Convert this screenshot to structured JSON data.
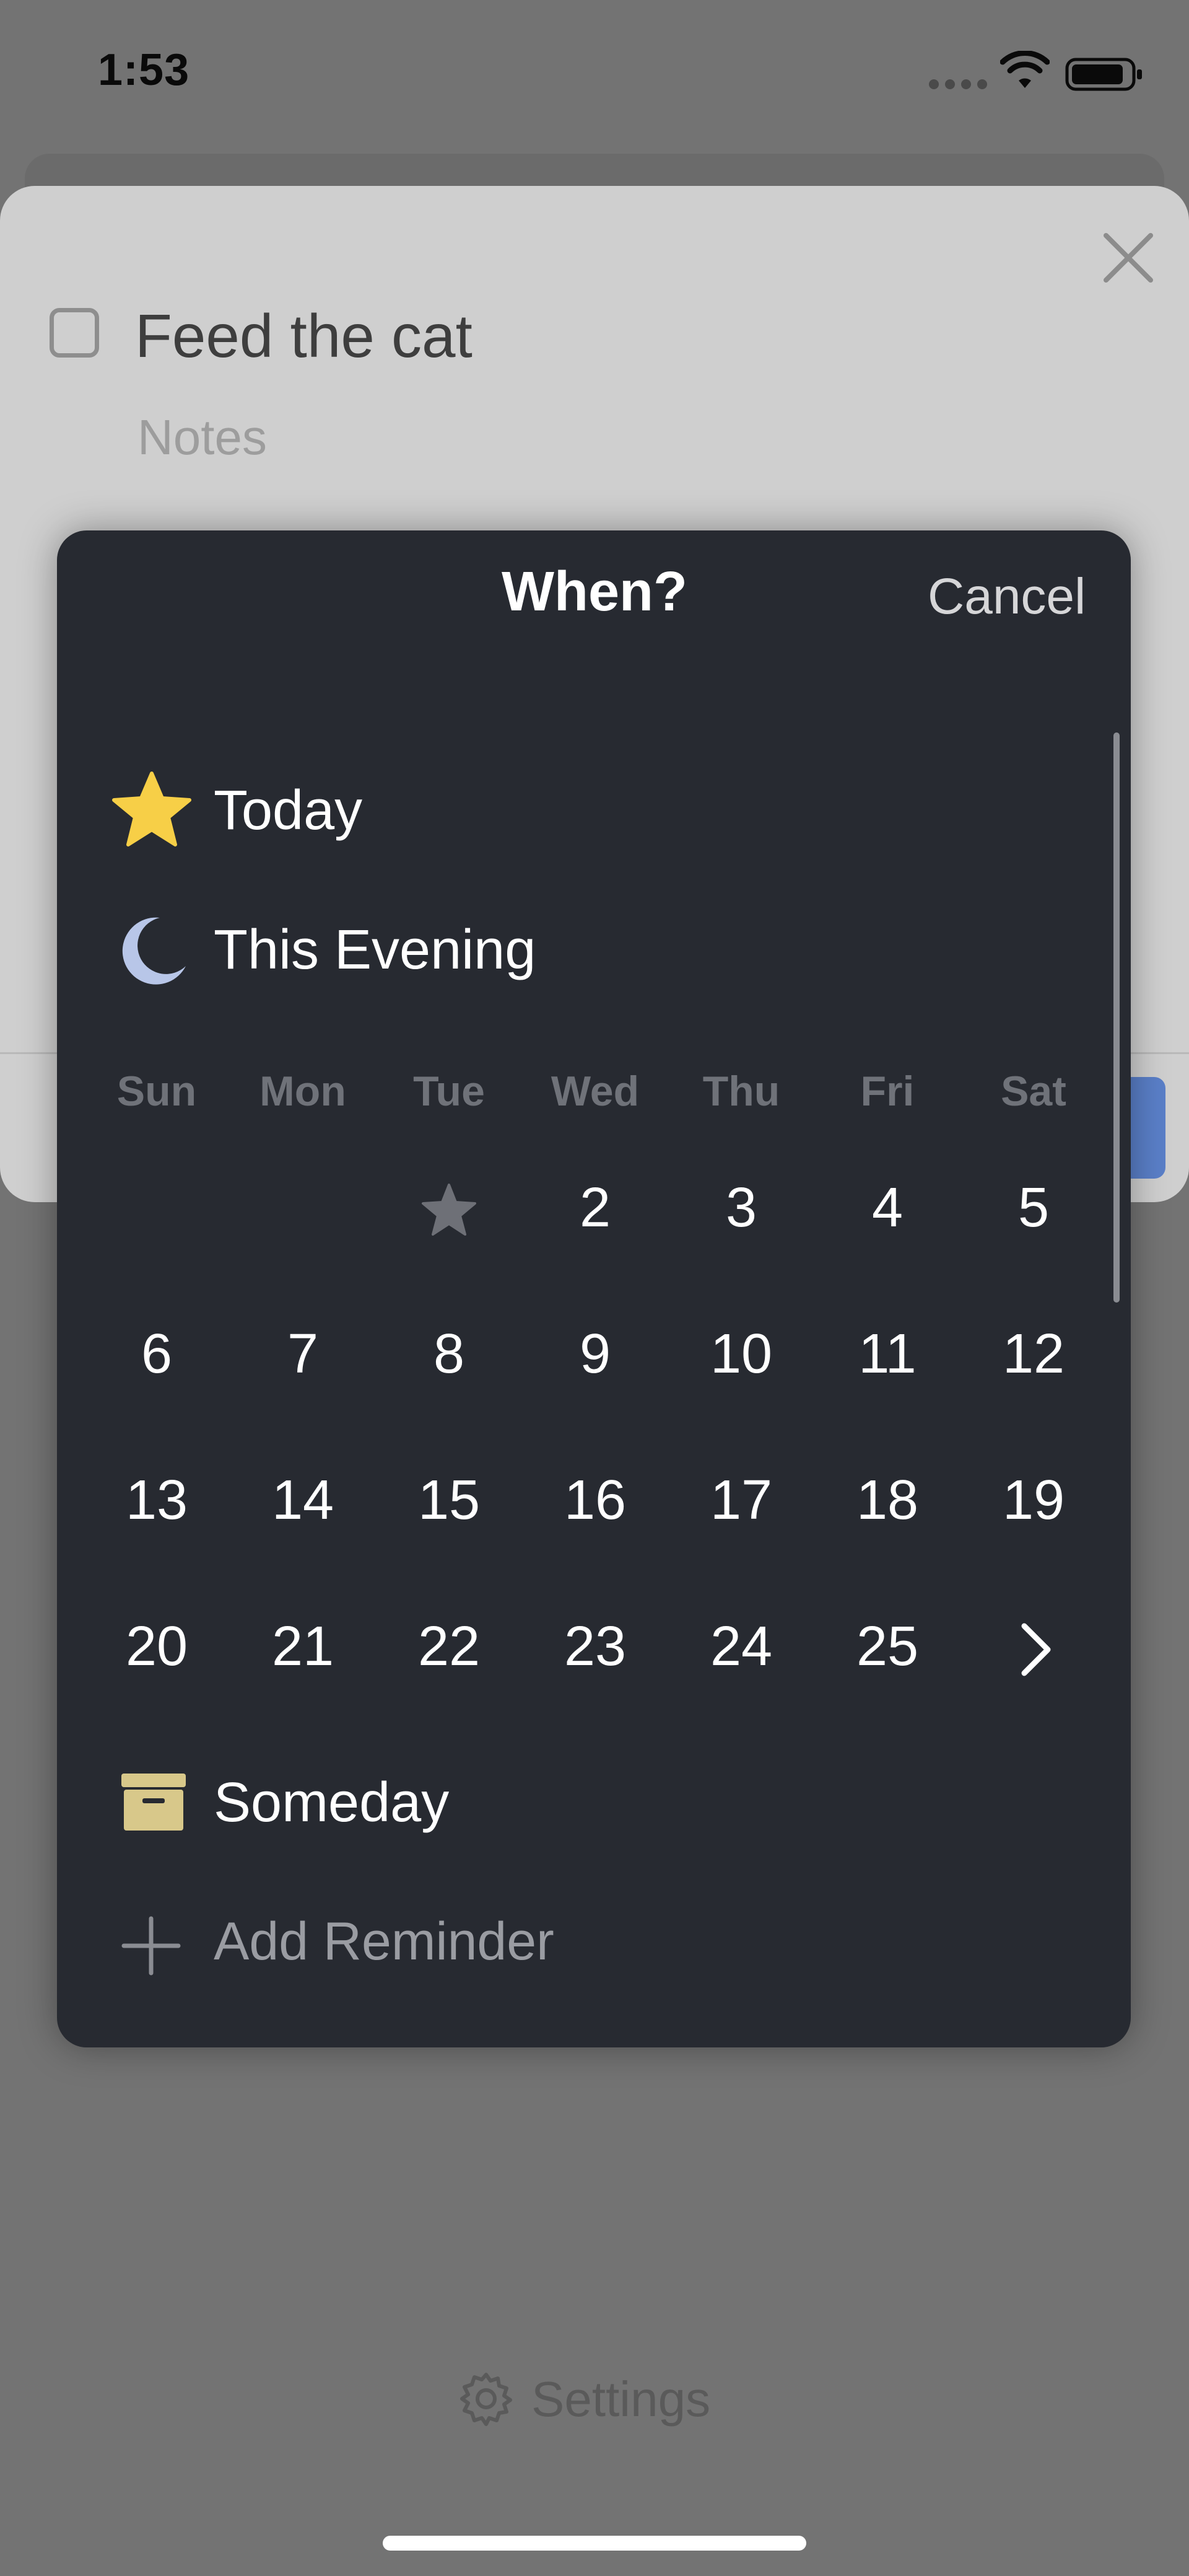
{
  "status_bar": {
    "time": "1:53",
    "icons": [
      "signal-dots-icon",
      "wifi-icon",
      "battery-icon"
    ]
  },
  "task": {
    "title": "Feed the cat",
    "notes_placeholder": "Notes",
    "close_icon": "close-icon",
    "checkbox_icon": "checkbox-icon"
  },
  "popup": {
    "title": "When?",
    "cancel_label": "Cancel",
    "options": {
      "today": {
        "label": "Today",
        "icon": "star-icon",
        "color": "#f7cf47"
      },
      "evening": {
        "label": "This Evening",
        "icon": "moon-icon",
        "color": "#b8c6e8"
      },
      "someday": {
        "label": "Someday",
        "icon": "archive-box-icon",
        "color": "#d8c88a"
      },
      "reminder": {
        "label": "Add Reminder",
        "icon": "plus-icon"
      }
    },
    "calendar": {
      "weekdays": [
        "Sun",
        "Mon",
        "Tue",
        "Wed",
        "Thu",
        "Fri",
        "Sat"
      ],
      "weeks": [
        [
          "",
          "",
          "today-star",
          "2",
          "3",
          "4",
          "5"
        ],
        [
          "6",
          "7",
          "8",
          "9",
          "10",
          "11",
          "12"
        ],
        [
          "13",
          "14",
          "15",
          "16",
          "17",
          "18",
          "19"
        ],
        [
          "20",
          "21",
          "22",
          "23",
          "24",
          "25",
          "next-month"
        ]
      ],
      "next_icon": "chevron-right-icon"
    }
  },
  "footer": {
    "settings_label": "Settings",
    "settings_icon": "gear-icon"
  },
  "colors": {
    "background": "#737373",
    "sheet": "#cfcfcf",
    "popup": "#272a31",
    "accent_blue": "#5a7fc8"
  }
}
